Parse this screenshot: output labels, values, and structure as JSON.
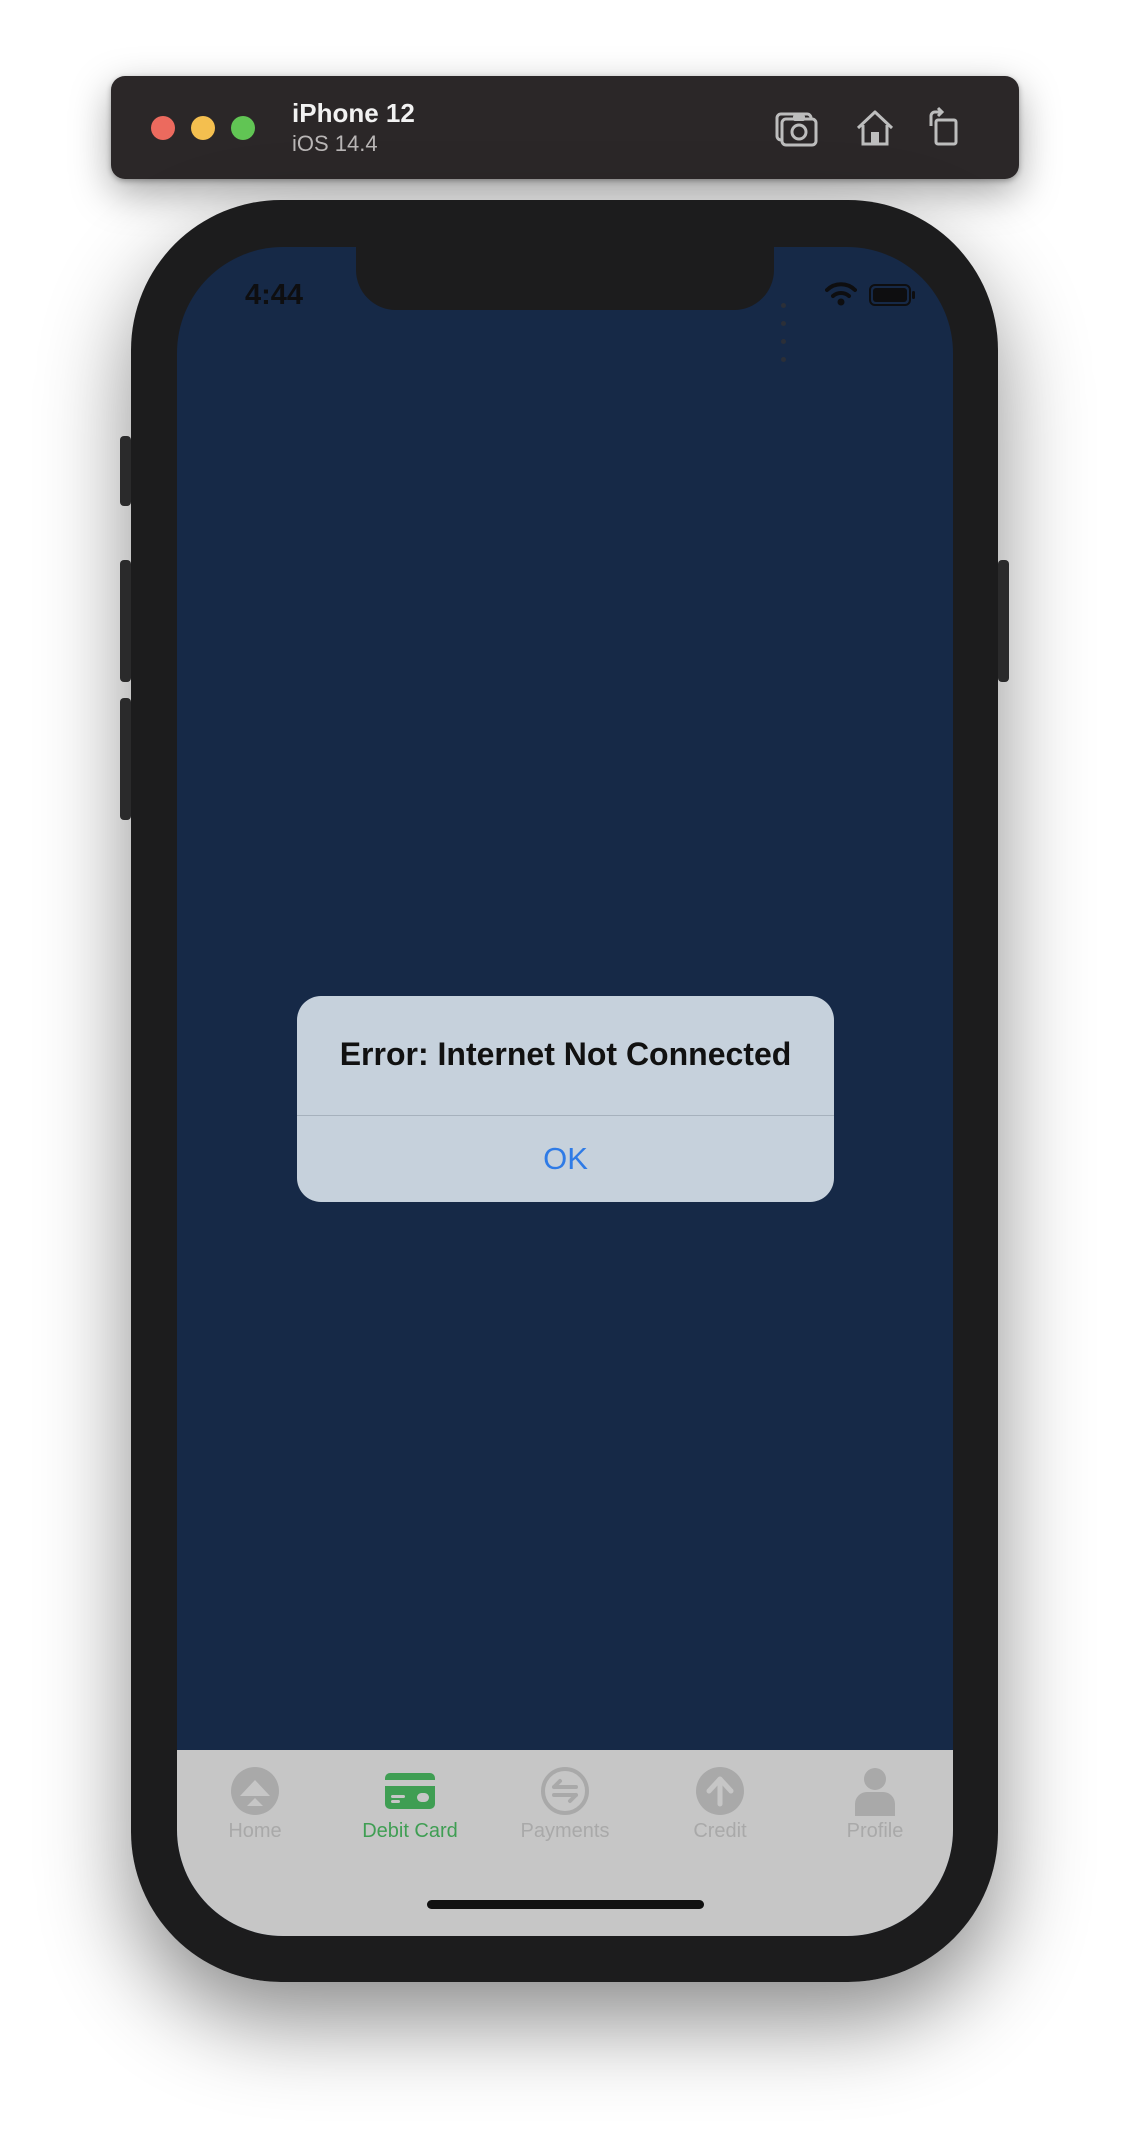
{
  "simulator": {
    "device_name": "iPhone 12",
    "os_version": "iOS 14.4",
    "toolbar_icons": [
      "screenshot-icon",
      "home-icon",
      "rotate-icon"
    ]
  },
  "status_bar": {
    "time": "4:44"
  },
  "screen": {
    "background_color": "#162947"
  },
  "alert": {
    "title": "Error: Internet Not Connected",
    "ok_label": "OK"
  },
  "tab_bar": {
    "active_color": "#3f9e53",
    "inactive_color": "#a9a9a9",
    "tabs": [
      {
        "label": "Home",
        "icon": "home-icon",
        "active": false
      },
      {
        "label": "Debit Card",
        "icon": "credit-card-icon",
        "active": true
      },
      {
        "label": "Payments",
        "icon": "payments-exchange-icon",
        "active": false
      },
      {
        "label": "Credit",
        "icon": "arrow-up-circle-icon",
        "active": false
      },
      {
        "label": "Profile",
        "icon": "person-icon",
        "active": false
      }
    ]
  }
}
